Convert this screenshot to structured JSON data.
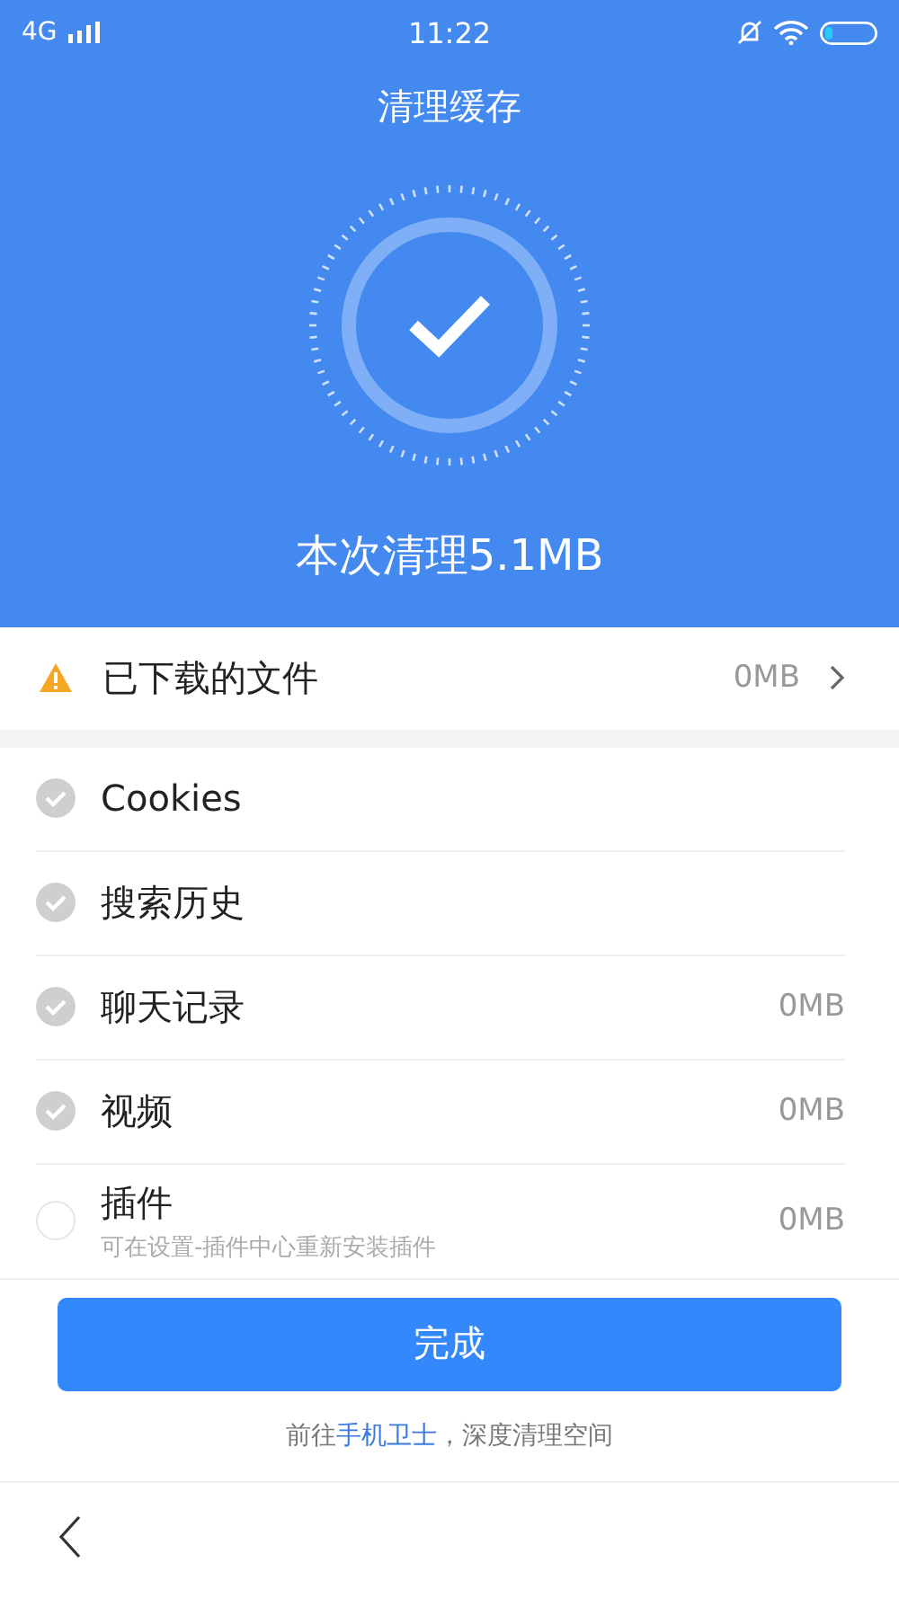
{
  "status_bar": {
    "network": "4G",
    "time": "11:22"
  },
  "header": {
    "title": "清理缓存",
    "result": "本次清理5.1MB"
  },
  "downloaded": {
    "label": "已下载的文件",
    "size": "0MB"
  },
  "items": [
    {
      "label": "Cookies",
      "checked": true
    },
    {
      "label": "搜索历史",
      "checked": true
    },
    {
      "label": "聊天记录",
      "size": "0MB",
      "checked": true
    },
    {
      "label": "视频",
      "size": "0MB",
      "checked": true
    },
    {
      "label": "插件",
      "size": "0MB",
      "note": "可在设置-插件中心重新安装插件",
      "checked": false
    }
  ],
  "done_button": "完成",
  "footer_note": {
    "before": "前往",
    "link": "手机卫士",
    "after": "，深度清理空间"
  }
}
